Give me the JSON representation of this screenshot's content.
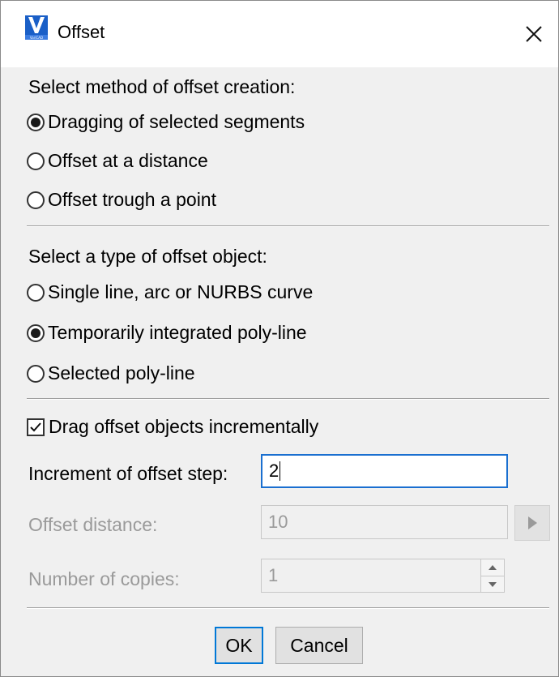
{
  "window": {
    "title": "Offset",
    "logo_text": "VariCAD",
    "colors": {
      "accent": "#0078d7",
      "icon_blue": "#1a5fc7"
    }
  },
  "method_section": {
    "heading": "Select method of offset creation:",
    "options": [
      {
        "label": "Dragging of selected segments",
        "selected": true
      },
      {
        "label": "Offset at a distance",
        "selected": false
      },
      {
        "label": "Offset trough a point",
        "selected": false
      }
    ]
  },
  "type_section": {
    "heading": "Select a type of offset object:",
    "options": [
      {
        "label": "Single line, arc or NURBS curve",
        "selected": false
      },
      {
        "label": "Temporarily integrated poly-line",
        "selected": true
      },
      {
        "label": "Selected poly-line",
        "selected": false
      }
    ]
  },
  "drag_incrementally": {
    "label": "Drag offset objects incrementally",
    "checked": true
  },
  "increment": {
    "label": "Increment of offset step:",
    "value": "2"
  },
  "offset_distance": {
    "label": "Offset distance:",
    "value": "10",
    "enabled": false
  },
  "copies": {
    "label": "Number of copies:",
    "value": "1",
    "enabled": false
  },
  "buttons": {
    "ok": "OK",
    "cancel": "Cancel"
  },
  "icons": [
    "varicad-logo-icon",
    "close-icon",
    "play-arrow-icon",
    "spin-up-icon",
    "spin-down-icon",
    "check-icon"
  ]
}
